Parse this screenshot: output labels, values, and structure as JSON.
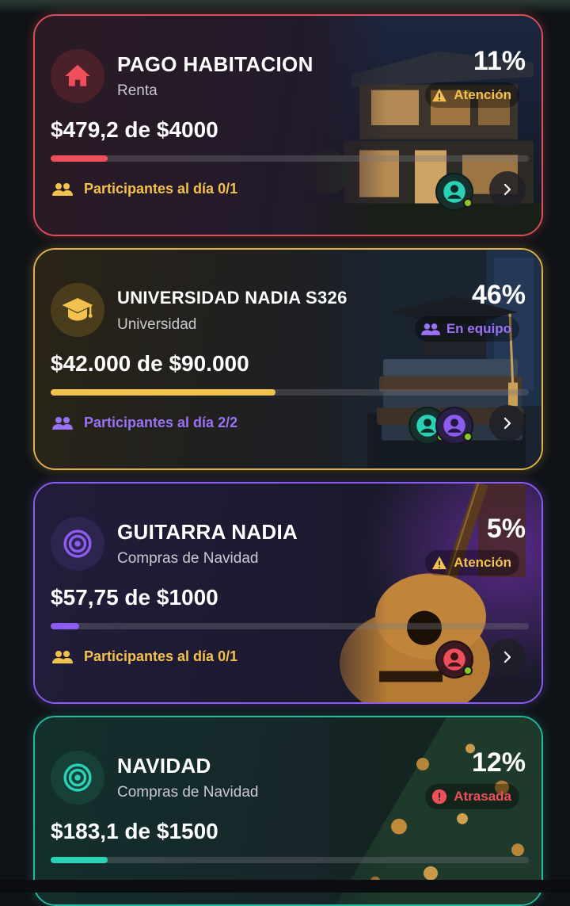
{
  "cards": [
    {
      "title": "PAGO HABITACION",
      "subtitle": "Renta",
      "percent": "11%",
      "status": "Atención",
      "amount": "$479,2 de $4000",
      "progress": 0.12,
      "participants": "Participantes al día 0/1",
      "icon": "house-icon",
      "accent": "#ef4f5a"
    },
    {
      "title": "UNIVERSIDAD NADIA S326",
      "subtitle": "Universidad",
      "percent": "46%",
      "status": "En equipo",
      "amount": "$42.000 de $90.000",
      "progress": 0.47,
      "participants": "Participantes al día 2/2",
      "icon": "graduation-cap-icon",
      "accent": "#f2c14e"
    },
    {
      "title": "GUITARRA NADIA",
      "subtitle": "Compras de Navidad",
      "percent": "5%",
      "status": "Atención",
      "amount": "$57,75 de $1000",
      "progress": 0.06,
      "participants": "Participantes al día 0/1",
      "icon": "target-icon",
      "accent": "#8c5cf0"
    },
    {
      "title": "NAVIDAD",
      "subtitle": "Compras de Navidad",
      "percent": "12%",
      "status": "Atrasada",
      "amount": "$183,1 de $1500",
      "progress": 0.12,
      "icon": "target-icon",
      "accent": "#2ad1b5"
    }
  ]
}
